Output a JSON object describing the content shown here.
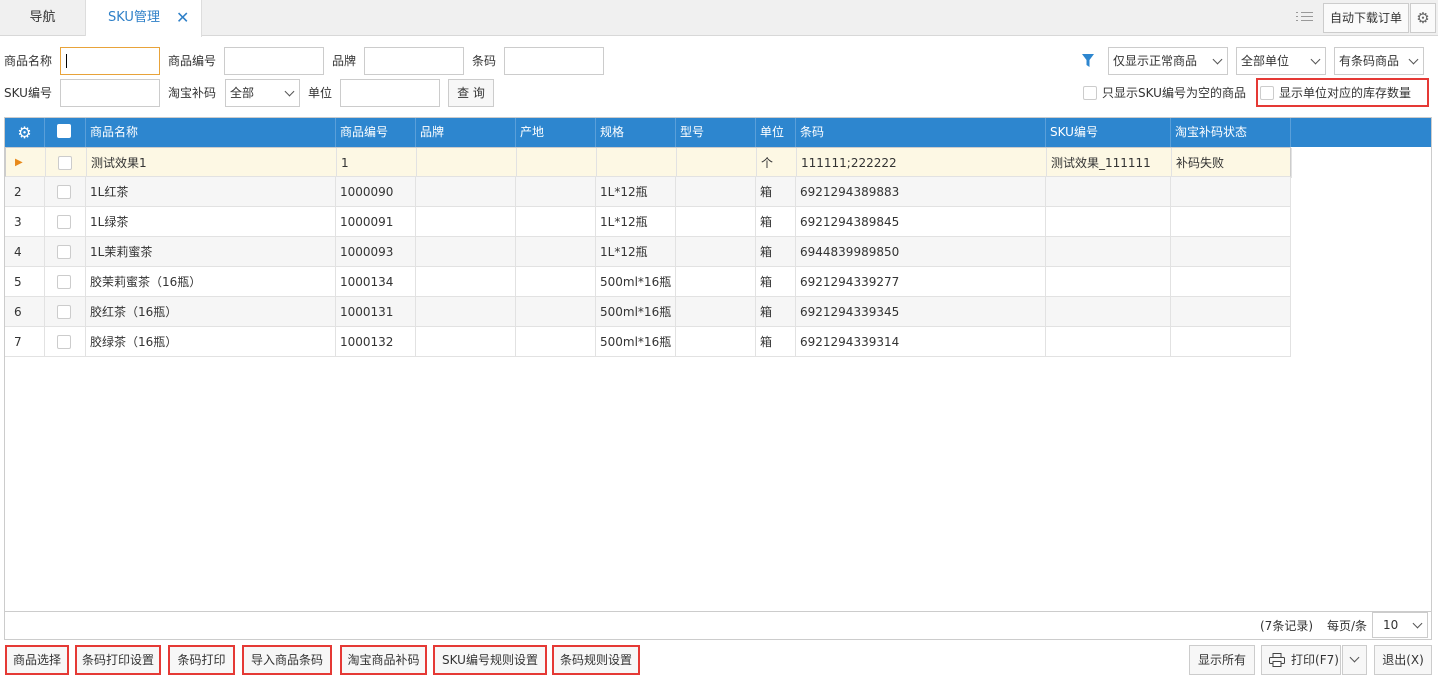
{
  "tabs": {
    "nav": "导航",
    "sku": "SKU管理",
    "close": "✕"
  },
  "toolbar": {
    "auto_download": "自动下载订单",
    "gear": "⚙"
  },
  "filters": {
    "name_label": "商品名称",
    "code_label": "商品编号",
    "brand_label": "品牌",
    "barcode_label": "条码",
    "sku_label": "SKU编号",
    "taobao_label": "淘宝补码",
    "taobao_value": "全部",
    "unit_label": "单位",
    "query": "查 询",
    "normal_select": "仅显示正常商品",
    "unit_select": "全部单位",
    "barcode_select": "有条码商品",
    "sku_empty_label": "只显示SKU编号为空的商品",
    "unit_stock_label": "显示单位对应的库存数量"
  },
  "grid": {
    "headers": [
      "商品名称",
      "商品编号",
      "品牌",
      "产地",
      "规格",
      "型号",
      "单位",
      "条码",
      "SKU编号",
      "淘宝补码状态"
    ],
    "rows": [
      {
        "n": "▶",
        "name": "测试效果1",
        "code": "1",
        "brand": "",
        "origin": "",
        "spec": "",
        "model": "",
        "unit": "个",
        "barcode": "111111;222222",
        "sku": "测试效果_111111",
        "status": "补码失败"
      },
      {
        "n": "2",
        "name": "1L红茶",
        "code": "1000090",
        "brand": "",
        "origin": "",
        "spec": "1L*12瓶",
        "model": "",
        "unit": "箱",
        "barcode": "6921294389883",
        "sku": "",
        "status": ""
      },
      {
        "n": "3",
        "name": "1L绿茶",
        "code": "1000091",
        "brand": "",
        "origin": "",
        "spec": "1L*12瓶",
        "model": "",
        "unit": "箱",
        "barcode": "6921294389845",
        "sku": "",
        "status": ""
      },
      {
        "n": "4",
        "name": "1L茉莉蜜茶",
        "code": "1000093",
        "brand": "",
        "origin": "",
        "spec": "1L*12瓶",
        "model": "",
        "unit": "箱",
        "barcode": "6944839989850",
        "sku": "",
        "status": ""
      },
      {
        "n": "5",
        "name": "胶茉莉蜜茶（16瓶）",
        "code": "1000134",
        "brand": "",
        "origin": "",
        "spec": "500ml*16瓶",
        "model": "",
        "unit": "箱",
        "barcode": "6921294339277",
        "sku": "",
        "status": ""
      },
      {
        "n": "6",
        "name": "胶红茶（16瓶）",
        "code": "1000131",
        "brand": "",
        "origin": "",
        "spec": "500ml*16瓶",
        "model": "",
        "unit": "箱",
        "barcode": "6921294339345",
        "sku": "",
        "status": ""
      },
      {
        "n": "7",
        "name": "胶绿茶（16瓶）",
        "code": "1000132",
        "brand": "",
        "origin": "",
        "spec": "500ml*16瓶",
        "model": "",
        "unit": "箱",
        "barcode": "6921294339314",
        "sku": "",
        "status": ""
      }
    ],
    "record_count": "(7条记录)",
    "per_page_label": "每页/条",
    "per_page_value": "10"
  },
  "bottom": {
    "select_goods": "商品选择",
    "barcode_print_settings": "条码打印设置",
    "barcode_print": "条码打印",
    "import_barcode": "导入商品条码",
    "taobao_recode": "淘宝商品补码",
    "sku_rule": "SKU编号规则设置",
    "barcode_rule": "条码规则设置",
    "show_all": "显示所有",
    "print": "打印(F7)",
    "exit": "退出(X)"
  },
  "colors": {
    "header": "#2d86cf",
    "accent": "#2f80c8",
    "highlight": "#e53935",
    "selected_row": "#fdf8e4"
  }
}
